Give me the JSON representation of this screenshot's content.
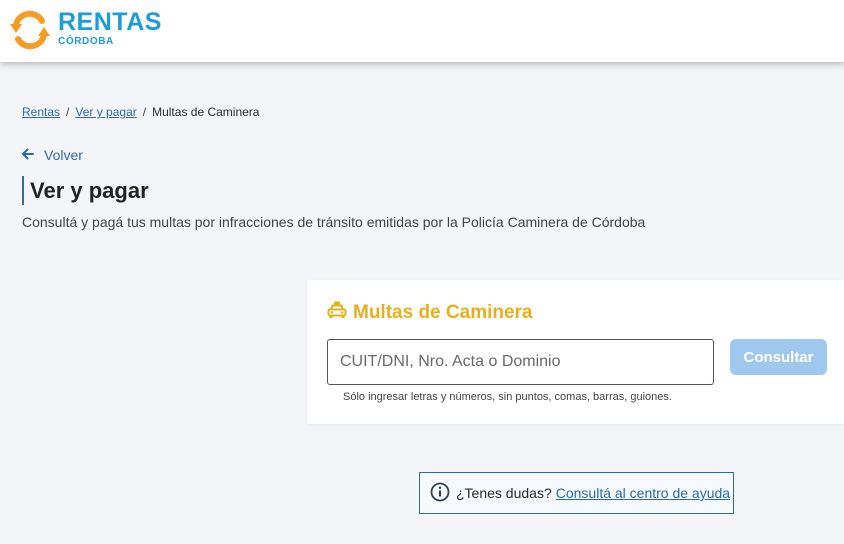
{
  "header": {
    "logo_icon": "circular-arrows-logo-icon",
    "logo_main": "RENTAS",
    "logo_sub": "CÓRDOBA"
  },
  "breadcrumb": {
    "items": [
      "Rentas",
      "Ver y pagar",
      "Multas de Caminera"
    ],
    "separator": "/"
  },
  "back": {
    "icon": "arrow-left-icon",
    "label": "Volver"
  },
  "page": {
    "title": "Ver y pagar",
    "subtitle": "Consultá y pagá tus multas por infracciones de tránsito emitidas por la Policía Caminera de Córdoba"
  },
  "card": {
    "icon": "car-icon",
    "title": "Multas de Caminera",
    "input_placeholder": "CUIT/DNI, Nro. Acta o Dominio",
    "input_value": "",
    "button_label": "Consultar",
    "hint": "Sólo ingresar letras y números, sin puntos, comas, barras, guiones."
  },
  "help": {
    "icon": "info-icon",
    "text": "¿Tenes dudas?",
    "link": "Consultá al centro de ayuda"
  },
  "colors": {
    "brand_blue": "#1f9bd8",
    "brand_orange": "#f39c26",
    "link_blue": "#2d6aa6",
    "accent_yellow": "#e5b01f",
    "button_disabled": "#9ec8ee",
    "page_bg": "#f4f5f9"
  }
}
